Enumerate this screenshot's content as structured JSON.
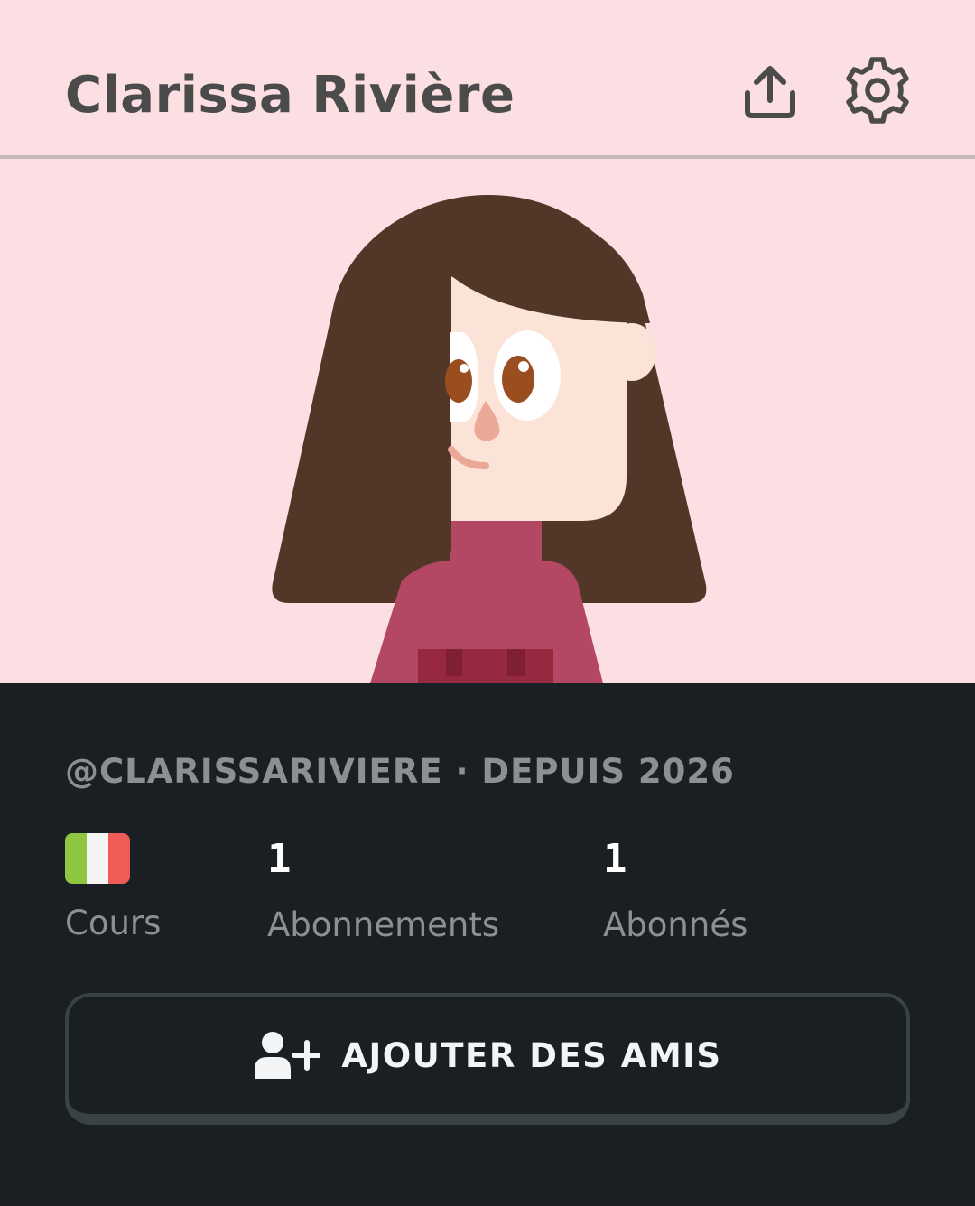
{
  "header": {
    "title": "Clarissa Rivière",
    "share_icon": "share-upload-icon",
    "settings_icon": "gear-icon",
    "background": "#fbdfe2"
  },
  "avatar": {
    "description_icon": "profile-avatar-illustration",
    "hair_color": "#523628",
    "skin_color": "#fbe3d8",
    "sweater_color": "#b34764"
  },
  "profile": {
    "handle_line": "@CLARISSARIVIERE · DEPUIS 2026"
  },
  "stats": {
    "courses": {
      "flag_icon": "italy-flag-icon",
      "flag_colors": [
        "#8ec641",
        "#f4f4f4",
        "#ef5b57"
      ],
      "label": "Cours"
    },
    "following": {
      "value": "1",
      "label": "Abonnements"
    },
    "followers": {
      "value": "1",
      "label": "Abonnés"
    }
  },
  "actions": {
    "add_friends_label": "AJOUTER DES AMIS",
    "add_friends_icon": "add-user-icon"
  },
  "colors": {
    "panel_bg": "#1a1f23",
    "muted_text": "#8b9094",
    "button_border": "#3b4246"
  }
}
